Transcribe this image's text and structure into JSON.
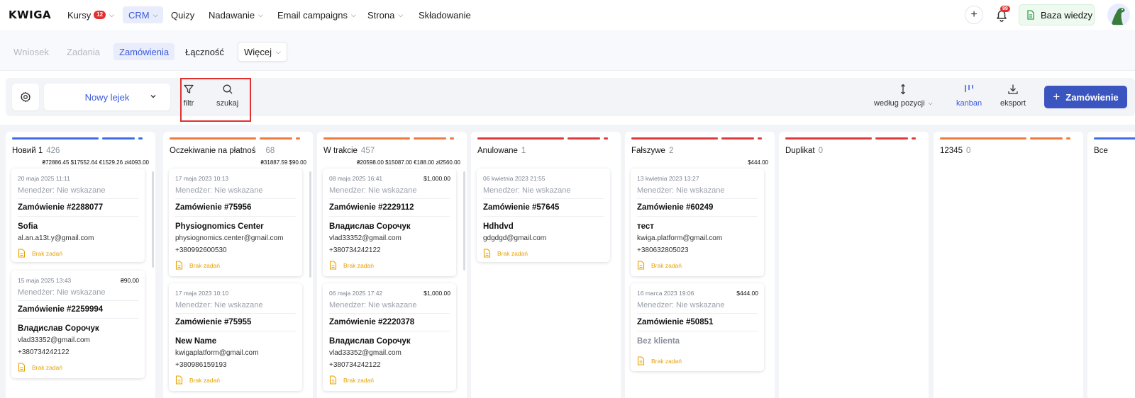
{
  "app": {
    "logo": "KWIGA"
  },
  "topnav": {
    "items": [
      {
        "label": "Kursy",
        "badge": "12"
      },
      {
        "label": "CRM"
      },
      {
        "label": "Quizy"
      },
      {
        "label": "Nadawanie"
      },
      {
        "label": "Email campaigns"
      },
      {
        "label": "Strona"
      },
      {
        "label": "Składowanie"
      }
    ],
    "notifications_badge": "99",
    "knowledge_base": "Baza wiedzy"
  },
  "subnav": {
    "items": [
      {
        "label": "Wniosek"
      },
      {
        "label": "Zadania"
      },
      {
        "label": "Zamówienia"
      },
      {
        "label": "Łączność"
      },
      {
        "label": "Więcej"
      }
    ]
  },
  "toolbar": {
    "funnel": "Nowy lejek",
    "filter": "filtr",
    "search": "szukaj",
    "sort": "według pozycji",
    "kanban": "kanban",
    "export": "eksport",
    "add_order": "Zamówienie"
  },
  "colors": {
    "accent": "#3b5bdb",
    "blue": "#3d6ee8",
    "orange": "#f07b3f",
    "red": "#e03b3b",
    "task": "#e6a100"
  },
  "columns": [
    {
      "title": "Новий 1",
      "count": "426",
      "sum": "₴72886.45 $17552.64 €1529.26 zł4093.00",
      "cards": [
        {
          "date": "20 maja 2025 11:11",
          "price": "",
          "manager": "Menedżer: Nie wskazane",
          "order": "Zamówienie #2288077",
          "name": "Sofia",
          "email": "al.an.a13t.y@gmail.com",
          "phone": "",
          "task": "Brak zadań"
        },
        {
          "date": "15 maja 2025 13:43",
          "price": "₴90.00",
          "manager": "Menedżer: Nie wskazane",
          "order": "Zamówienie #2259994",
          "name": "Владислав Сорочук",
          "email": "vlad33352@gmail.com",
          "phone": "+380734242122",
          "task": "Brak zadań"
        }
      ]
    },
    {
      "title": "Oczekiwanie na płatnoś",
      "count": "68",
      "sum": "₴31887.59 $90.00",
      "cards": [
        {
          "date": "17 maja 2023 10:13",
          "price": "",
          "manager": "Menedżer: Nie wskazane",
          "order": "Zamówienie #75956",
          "name": "Physiognomics Center",
          "email": "physiognomics.center@gmail.com",
          "phone": "+380992600530",
          "task": "Brak zadań"
        },
        {
          "date": "17 maja 2023 10:10",
          "price": "",
          "manager": "Menedżer: Nie wskazane",
          "order": "Zamówienie #75955",
          "name": "New Name",
          "email": "kwigaplatform@gmail.com",
          "phone": "+380986159193",
          "task": "Brak zadań"
        }
      ]
    },
    {
      "title": "W trakcie",
      "count": "457",
      "sum": "₴20598.00 $15087.00 €188.00 zł2560.00",
      "cards": [
        {
          "date": "08 maja 2025 16:41",
          "price": "$1,000.00",
          "manager": "Menedżer: Nie wskazane",
          "order": "Zamówienie #2229112",
          "name": "Владислав Сорочук",
          "email": "vlad33352@gmail.com",
          "phone": "+380734242122",
          "task": "Brak zadań"
        },
        {
          "date": "06 maja 2025 17:42",
          "price": "$1,000.00",
          "manager": "Menedżer: Nie wskazane",
          "order": "Zamówienie #2220378",
          "name": "Владислав Сорочук",
          "email": "vlad33352@gmail.com",
          "phone": "+380734242122",
          "task": "Brak zadań"
        }
      ]
    },
    {
      "title": "Anulowane",
      "count": "1",
      "sum": "",
      "cards": [
        {
          "date": "06 kwietnia 2023 21:55",
          "price": "",
          "manager": "Menedżer: Nie wskazane",
          "order": "Zamówienie #57645",
          "name": "Hdhdvd",
          "email": "gdgdgd@gmail.com",
          "phone": "",
          "task": "Brak zadań"
        }
      ]
    },
    {
      "title": "Fałszywe",
      "count": "2",
      "sum": "$444.00",
      "cards": [
        {
          "date": "13 kwietnia 2023 13:27",
          "price": "",
          "manager": "Menedżer: Nie wskazane",
          "order": "Zamówienie #60249",
          "name": "тест",
          "email": "kwiga.platform@gmail.com",
          "phone": "+380632805023",
          "task": "Brak zadań"
        },
        {
          "date": "16 marca 2023 19:06",
          "price": "$444.00",
          "manager": "Menedżer: Nie wskazane",
          "order": "Zamówienie #50851",
          "name": "Bez klienta",
          "email": "",
          "phone": "",
          "task": "Brak zadań"
        }
      ]
    },
    {
      "title": "Duplikat",
      "count": "0",
      "sum": "",
      "cards": []
    },
    {
      "title": "12345",
      "count": "0",
      "sum": "",
      "cards": []
    },
    {
      "title": "Все",
      "count": "",
      "sum": "",
      "cards": []
    }
  ]
}
